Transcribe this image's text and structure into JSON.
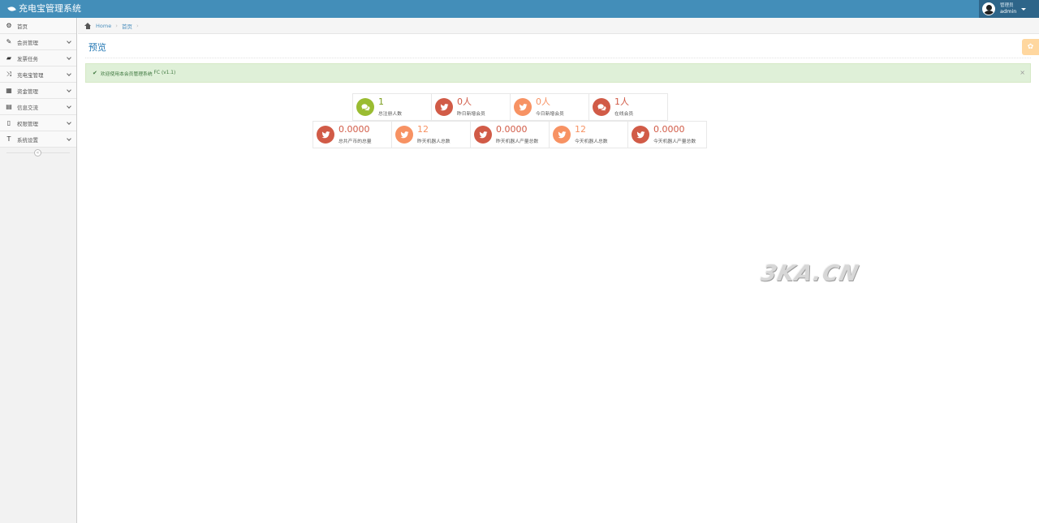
{
  "app": {
    "title": "充电宝管理系统"
  },
  "user": {
    "role": "管理员",
    "name": "admin"
  },
  "sidebar": {
    "items": [
      {
        "label": "首页",
        "icon": "tachometer-icon",
        "glyph": "⚙",
        "has_arrow": false
      },
      {
        "label": "会员管理",
        "icon": "edit-icon",
        "glyph": "✎",
        "has_arrow": true
      },
      {
        "label": "发票任务",
        "icon": "book-icon",
        "glyph": "▰",
        "has_arrow": true
      },
      {
        "label": "充电宝管理",
        "icon": "random-icon",
        "glyph": "⤨",
        "has_arrow": true
      },
      {
        "label": "资金管理",
        "icon": "calendar-icon",
        "glyph": "▦",
        "has_arrow": true
      },
      {
        "label": "信息交流",
        "icon": "list-alt-icon",
        "glyph": "▤",
        "has_arrow": true
      },
      {
        "label": "权限管理",
        "icon": "file-icon",
        "glyph": "▯",
        "has_arrow": true
      },
      {
        "label": "系统设置",
        "icon": "text-height-icon",
        "glyph": "T",
        "has_arrow": true
      }
    ],
    "collapse_glyph": "«"
  },
  "breadcrumb": {
    "home": "Home",
    "current": "首页"
  },
  "page": {
    "title": "预览"
  },
  "alert": {
    "text": "欢迎使用本会员管理系统",
    "brand": "FC",
    "version": "(v1.1)",
    "close": "×"
  },
  "stats_row1": [
    {
      "value": "1",
      "label": "总注册人数",
      "color": "green",
      "icon": "comments-icon"
    },
    {
      "value": "0人",
      "label": "昨日新增会员",
      "color": "red",
      "icon": "twitter-icon"
    },
    {
      "value": "0人",
      "label": "今日新增会员",
      "color": "orange",
      "icon": "twitter-icon"
    },
    {
      "value": "1人",
      "label": "在线会员",
      "color": "red",
      "icon": "comments-icon"
    }
  ],
  "stats_row2": [
    {
      "value": "0.0000",
      "label": "总共产币的总量",
      "color": "red",
      "icon": "twitter-icon"
    },
    {
      "value": "12",
      "label": "昨天机器人总数",
      "color": "orange",
      "icon": "twitter-icon"
    },
    {
      "value": "0.0000",
      "label": "昨天机器人产量总数",
      "color": "red",
      "icon": "twitter-icon"
    },
    {
      "value": "12",
      "label": "今天机器人总数",
      "color": "orange",
      "icon": "twitter-icon"
    },
    {
      "value": "0.0000",
      "label": "今天机器人产量总数",
      "color": "red",
      "icon": "twitter-icon"
    }
  ],
  "watermark": "3KA.CN",
  "colors": {
    "navbar": "#438eb9",
    "green": "#9abc32",
    "red": "#d15b47",
    "orange": "#f79263"
  }
}
